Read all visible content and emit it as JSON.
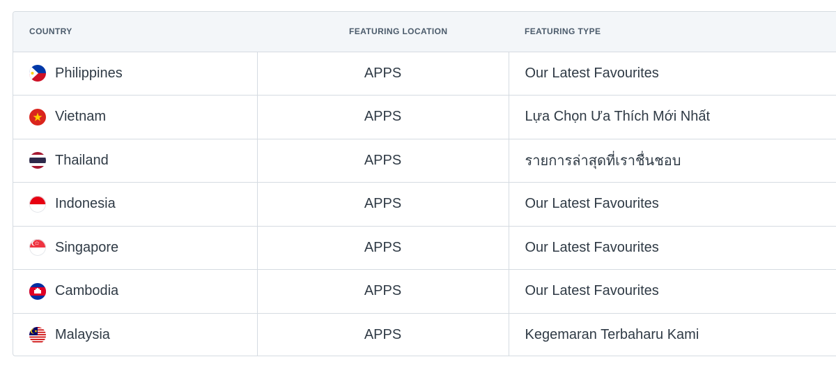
{
  "table": {
    "headers": {
      "country": "COUNTRY",
      "location": "FEATURING LOCATION",
      "type": "FEATURING TYPE"
    },
    "rows": [
      {
        "country": "Philippines",
        "flag_icon": "philippines-flag-icon",
        "location": "APPS",
        "type": "Our Latest Favourites"
      },
      {
        "country": "Vietnam",
        "flag_icon": "vietnam-flag-icon",
        "location": "APPS",
        "type": "Lựa Chọn Ưa Thích Mới Nhất"
      },
      {
        "country": "Thailand",
        "flag_icon": "thailand-flag-icon",
        "location": "APPS",
        "type": "รายการล่าสุดที่เราชื่นชอบ"
      },
      {
        "country": "Indonesia",
        "flag_icon": "indonesia-flag-icon",
        "location": "APPS",
        "type": "Our Latest Favourites"
      },
      {
        "country": "Singapore",
        "flag_icon": "singapore-flag-icon",
        "location": "APPS",
        "type": "Our Latest Favourites"
      },
      {
        "country": "Cambodia",
        "flag_icon": "cambodia-flag-icon",
        "location": "APPS",
        "type": "Our Latest Favourites"
      },
      {
        "country": "Malaysia",
        "flag_icon": "malaysia-flag-icon",
        "location": "APPS",
        "type": "Kegemaran Terbaharu Kami"
      }
    ]
  },
  "colors": {
    "header_bg": "#f3f6f9",
    "border": "#d5dbe1",
    "text": "#2f3a45",
    "header_text": "#4b5b6b"
  }
}
